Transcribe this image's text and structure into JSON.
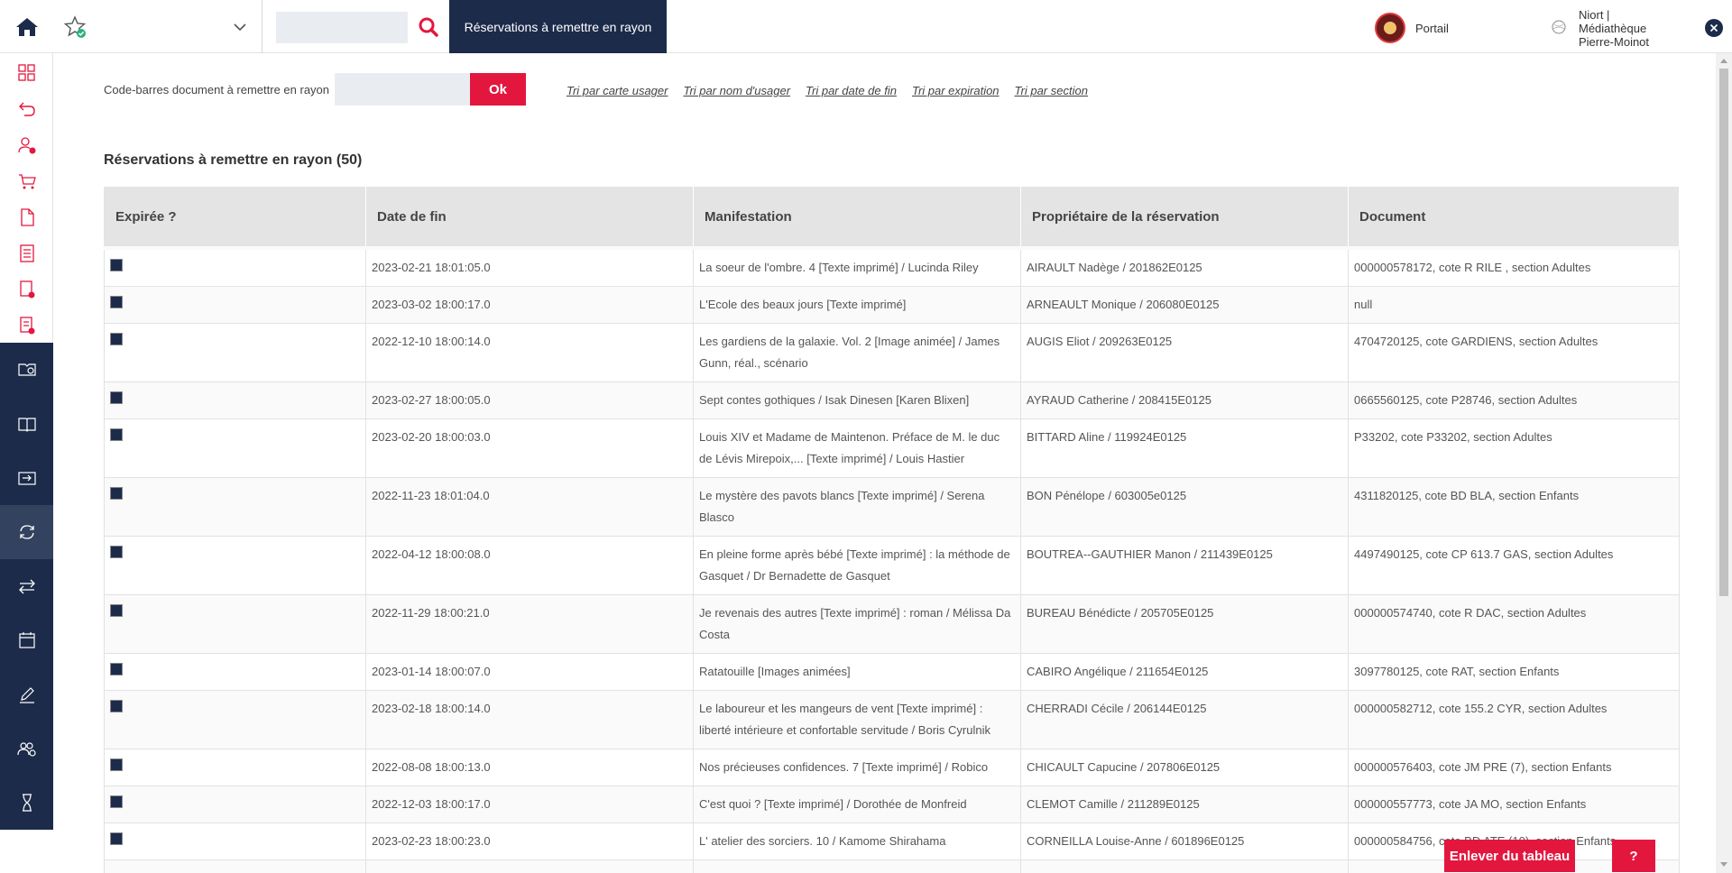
{
  "topbar": {
    "active_tab": "Réservations à remettre en rayon",
    "portal_label": "Portail",
    "site_label_line1": "Niort |",
    "site_label_line2": "Médiathèque",
    "site_label_line3": "Pierre-Moinot",
    "search_placeholder": ""
  },
  "toolbar": {
    "barcode_label": "Code-barres document à remettre en rayon",
    "barcode_value": "",
    "ok_label": "Ok",
    "sort_links": [
      "Tri par carte usager",
      "Tri par nom d'usager",
      "Tri par date de fin",
      "Tri par expiration",
      "Tri par section"
    ]
  },
  "section_title": "Réservations à remettre en rayon (50)",
  "table": {
    "headers": [
      "Expirée ?",
      "Date de fin",
      "Manifestation",
      "Propriétaire de la réservation",
      "Document"
    ],
    "rows": [
      {
        "date": "2023-02-21 18:01:05.0",
        "manifestation": "La soeur de l'ombre. 4 [Texte imprimé] / Lucinda Riley",
        "owner": "AIRAULT Nadège / 201862E0125",
        "document": "000000578172, cote R RILE , section Adultes"
      },
      {
        "date": "2023-03-02 18:00:17.0",
        "manifestation": "L'Ecole des beaux jours [Texte imprimé]",
        "owner": "ARNEAULT Monique / 206080E0125",
        "document": "null"
      },
      {
        "date": "2022-12-10 18:00:14.0",
        "manifestation": "Les gardiens de la galaxie. Vol. 2 [Image animée] / James Gunn, réal., scénario",
        "owner": "AUGIS Eliot / 209263E0125",
        "document": "4704720125, cote GARDIENS, section Adultes"
      },
      {
        "date": "2023-02-27 18:00:05.0",
        "manifestation": "Sept contes gothiques / Isak Dinesen [Karen Blixen]",
        "owner": "AYRAUD Catherine / 208415E0125",
        "document": "0665560125, cote P28746, section Adultes"
      },
      {
        "date": "2023-02-20 18:00:03.0",
        "manifestation": "Louis XIV et Madame de Maintenon. Préface de M. le duc de Lévis Mirepoix,... [Texte imprimé] / Louis Hastier",
        "owner": "BITTARD Aline / 119924E0125",
        "document": "P33202, cote P33202, section Adultes"
      },
      {
        "date": "2022-11-23 18:01:04.0",
        "manifestation": "Le mystère des pavots blancs [Texte imprimé] / Serena Blasco",
        "owner": "BON Pénélope / 603005e0125",
        "document": "4311820125, cote BD BLA, section Enfants"
      },
      {
        "date": "2022-04-12 18:00:08.0",
        "manifestation": "En pleine forme après bébé [Texte imprimé] : la méthode de Gasquet / Dr Bernadette de Gasquet",
        "owner": "BOUTREA--GAUTHIER Manon / 211439E0125",
        "document": "4497490125, cote CP 613.7 GAS, section Adultes"
      },
      {
        "date": "2022-11-29 18:00:21.0",
        "manifestation": "Je revenais des autres [Texte imprimé] : roman / Mélissa Da Costa",
        "owner": "BUREAU Bénédicte / 205705E0125",
        "document": "000000574740, cote R DAC, section Adultes"
      },
      {
        "date": "2023-01-14 18:00:07.0",
        "manifestation": "Ratatouille [Images animées]",
        "owner": "CABIRO Angélique / 211654E0125",
        "document": "3097780125, cote RAT, section Enfants"
      },
      {
        "date": "2023-02-18 18:00:14.0",
        "manifestation": "Le laboureur et les mangeurs de vent [Texte imprimé] : liberté intérieure et confortable servitude / Boris Cyrulnik",
        "owner": "CHERRADI Cécile / 206144E0125",
        "document": "000000582712, cote 155.2 CYR, section Adultes"
      },
      {
        "date": "2022-08-08 18:00:13.0",
        "manifestation": "Nos précieuses confidences. 7 [Texte imprimé] / Robico",
        "owner": "CHICAULT Capucine / 207806E0125",
        "document": "000000576403, cote JM PRE (7), section Enfants"
      },
      {
        "date": "2022-12-03 18:00:17.0",
        "manifestation": "C'est quoi ? [Texte imprimé] / Dorothée de Monfreid",
        "owner": "CLEMOT Camille / 211289E0125",
        "document": "000000557773, cote JA MO, section Enfants"
      },
      {
        "date": "2023-02-23 18:00:23.0",
        "manifestation": "L' atelier des sorciers. 10 / Kamome Shirahama",
        "owner": "CORNEILLA Louise-Anne / 601896E0125",
        "document": "000000584756, cote BD ATE (10), section Enfants"
      },
      {
        "date": "",
        "manifestation": "",
        "owner": "",
        "document": ""
      }
    ]
  },
  "actions": {
    "remove_label": "Enlever du tableau",
    "help_label": "?"
  },
  "colors": {
    "navy": "#1c2b4a",
    "accent_red": "#e3173e",
    "header_gray": "#e4e4e4"
  }
}
